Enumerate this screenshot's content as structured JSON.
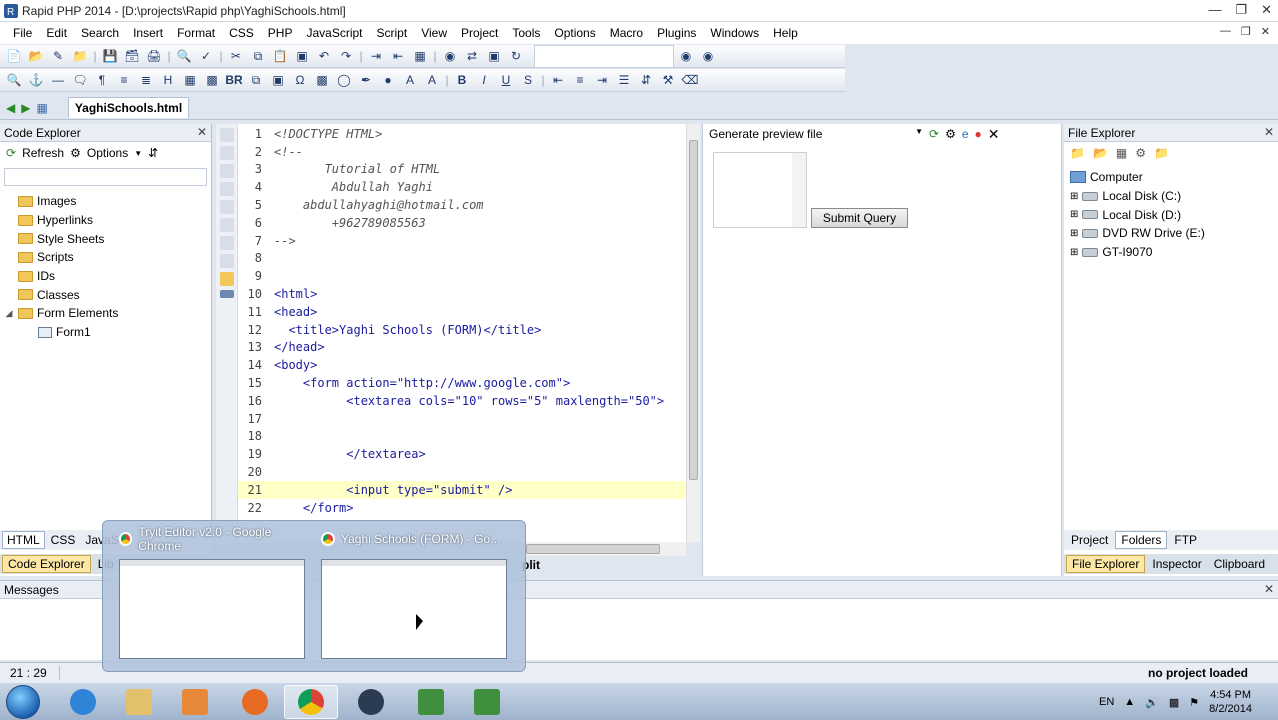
{
  "window": {
    "title": "Rapid PHP 2014 - [D:\\projects\\Rapid php\\YaghiSchools.html]"
  },
  "menu": [
    "File",
    "Edit",
    "Search",
    "Insert",
    "Format",
    "CSS",
    "PHP",
    "JavaScript",
    "Script",
    "View",
    "Project",
    "Tools",
    "Options",
    "Macro",
    "Plugins",
    "Windows",
    "Help"
  ],
  "toolbar2": {
    "bold": "B",
    "italic": "I",
    "underline": "U",
    "br": "BR"
  },
  "doc_tab": "YaghiSchools.html",
  "code_explorer": {
    "title": "Code Explorer",
    "refresh": "Refresh",
    "options": "Options",
    "items": [
      "Images",
      "Hyperlinks",
      "Style Sheets",
      "Scripts",
      "IDs",
      "Classes",
      "Form Elements",
      "Form1"
    ]
  },
  "left_tabs": [
    "HTML",
    "CSS",
    "JavaS"
  ],
  "left_tabs2": [
    "Code Explorer",
    "Lib"
  ],
  "editor": {
    "lines": [
      {
        "n": "1",
        "t": "<!DOCTYPE HTML>",
        "k": "com"
      },
      {
        "n": "2",
        "t": "<!--",
        "k": "com"
      },
      {
        "n": "3",
        "t": "       Tutorial of HTML",
        "k": "com"
      },
      {
        "n": "4",
        "t": "        Abdullah Yaghi",
        "k": "com"
      },
      {
        "n": "5",
        "t": "    abdullahyaghi@hotmail.com",
        "k": "com"
      },
      {
        "n": "6",
        "t": "        +962789085563",
        "k": "com"
      },
      {
        "n": "7",
        "t": "-->",
        "k": "com"
      },
      {
        "n": "8",
        "t": "",
        "k": "txt"
      },
      {
        "n": "9",
        "t": "",
        "k": "txt"
      },
      {
        "n": "10",
        "t": "<html>",
        "k": "tag"
      },
      {
        "n": "11",
        "t": "<head>",
        "k": "tag"
      },
      {
        "n": "12",
        "t": "  <title>Yaghi Schools (FORM)</title>",
        "k": "mix"
      },
      {
        "n": "13",
        "t": "</head>",
        "k": "tag"
      },
      {
        "n": "14",
        "t": "<body>",
        "k": "tag"
      },
      {
        "n": "15",
        "t": "    <form action=\"http://www.google.com\">",
        "k": "tag"
      },
      {
        "n": "16",
        "t": "          <textarea cols=\"10\" rows=\"5\" maxlength=\"50\">",
        "k": "tag"
      },
      {
        "n": "17",
        "t": "",
        "k": "txt"
      },
      {
        "n": "18",
        "t": "",
        "k": "txt"
      },
      {
        "n": "19",
        "t": "          </textarea>",
        "k": "tag"
      },
      {
        "n": "20",
        "t": "",
        "k": "txt"
      },
      {
        "n": "21",
        "t": "          <input type=\"submit\" />",
        "k": "tag",
        "hl": true
      },
      {
        "n": "22",
        "t": "    </form>",
        "k": "tag"
      }
    ]
  },
  "preview": {
    "select": "Generate preview file",
    "submit": "Submit Query",
    "split": "plit"
  },
  "file_explorer": {
    "title": "File Explorer",
    "items": [
      "Computer",
      "Local Disk (C:)",
      "Local Disk (D:)",
      "DVD RW Drive (E:)",
      "GT-I9070"
    ]
  },
  "right_tabs": [
    "Project",
    "Folders",
    "FTP"
  ],
  "right_tabs2": [
    "File Explorer",
    "Inspector",
    "Clipboard"
  ],
  "messages": {
    "title": "Messages"
  },
  "status": {
    "position": "21 : 29",
    "project": "no project loaded"
  },
  "taskbar_preview": {
    "items": [
      {
        "title": "Tryit Editor v2.0 - Google Chrome"
      },
      {
        "title": "Yaghi Schools (FORM) - Go..."
      }
    ]
  },
  "tray": {
    "lang": "EN",
    "time": "4:54 PM",
    "date": "8/2/2014"
  },
  "colors": {
    "accent": "#1b1ba1",
    "highlight": "#ffffc8"
  }
}
